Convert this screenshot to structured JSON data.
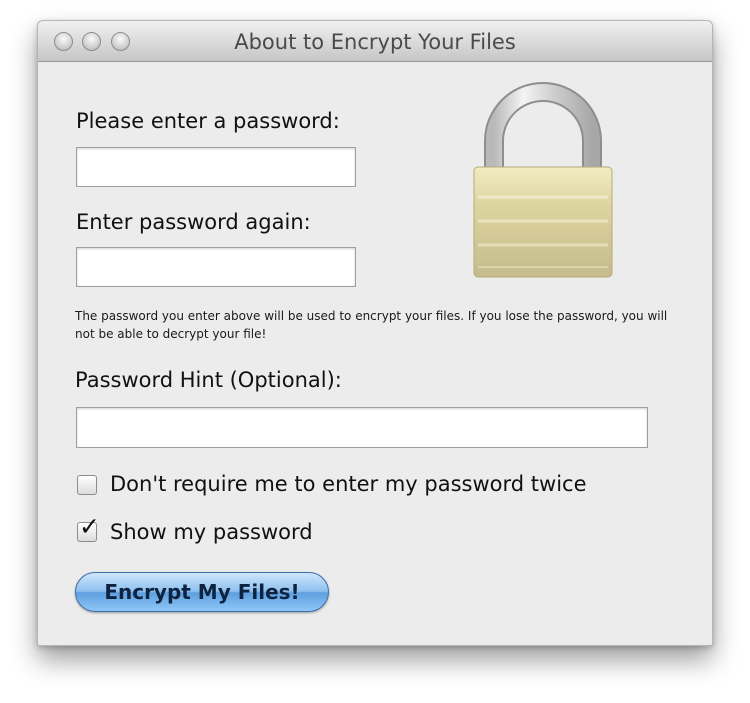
{
  "window": {
    "title": "About to Encrypt Your Files"
  },
  "form": {
    "password_label": "Please enter a password:",
    "password_value": "",
    "confirm_label": "Enter password again:",
    "confirm_value": "",
    "note": "The password you enter above will be used to encrypt your files.  If you lose the password, you will not be able to decrypt your file!",
    "hint_label": "Password Hint (Optional):",
    "hint_value": "",
    "no_repeat_label": "Don't require me to enter my password twice",
    "no_repeat_checked": false,
    "show_password_label": "Show my password",
    "show_password_checked": true,
    "encrypt_button": "Encrypt My Files!"
  },
  "icons": {
    "lock": "padlock-icon",
    "window_controls": [
      "close-icon",
      "minimize-icon",
      "zoom-icon"
    ]
  },
  "colors": {
    "window_bg": "#ececec",
    "button_blue": "#7fb6ea",
    "lock_gold": "#d7cf9a"
  }
}
